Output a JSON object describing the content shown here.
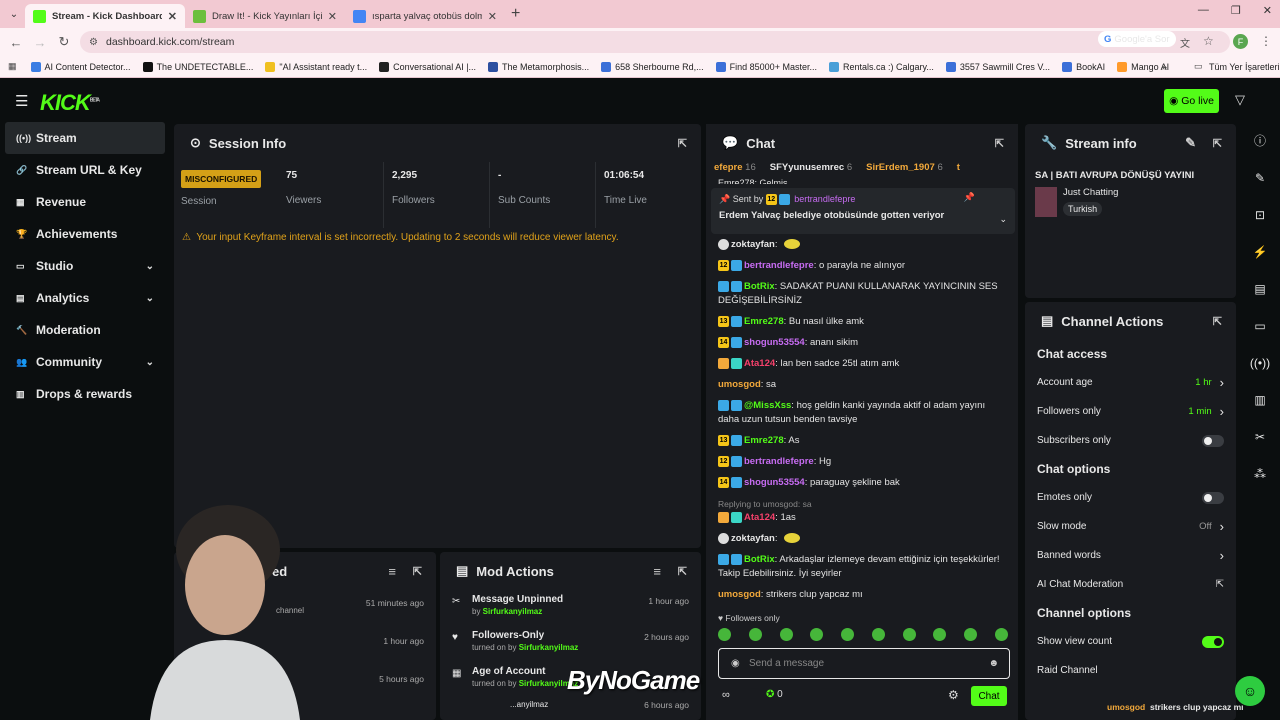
{
  "browser": {
    "tabs": [
      {
        "title": "Stream - Kick Dashboard",
        "color": "#53fc18",
        "active": true
      },
      {
        "title": "Draw It! - Kick Yayınları İçin Çizi",
        "color": "#6cbf3c",
        "active": false
      },
      {
        "title": "ısparta yalvaç otobüs dolmuş",
        "color": "#4285f4",
        "active": false
      }
    ],
    "new_tab": "+",
    "url": "dashboard.kick.com/stream",
    "google_label": "Google'a Sor",
    "profile_initial": "F",
    "bookmarks": [
      {
        "label": "AI Content Detector...",
        "color": "#3b7de3"
      },
      {
        "label": "The UNDETECTABLE...",
        "color": "#111111"
      },
      {
        "label": "\"AI Assistant ready t...",
        "color": "#f0c020"
      },
      {
        "label": "Conversational AI |...",
        "color": "#222222"
      },
      {
        "label": "The Metamorphosis...",
        "color": "#2d4fa0"
      },
      {
        "label": "658 Sherbourne Rd,...",
        "color": "#3c6fd8"
      },
      {
        "label": "Find 85000+ Master...",
        "color": "#3c6fd8"
      },
      {
        "label": "Rentals.ca :) Calgary...",
        "color": "#4a9fd8"
      },
      {
        "label": "3557 Sawmill Cres V...",
        "color": "#3c6fd8"
      },
      {
        "label": "BookAI",
        "color": "#3c6fd8"
      },
      {
        "label": "Mango AI",
        "color": "#ff9a2a"
      }
    ],
    "all_bookmarks": "Tüm Yer İşaretleri"
  },
  "app": {
    "logo": "KICK",
    "logo_beta": "BETA",
    "go_live": "Go live"
  },
  "sidebar": {
    "items": [
      {
        "label": "Stream",
        "icon": "stream-icon",
        "active": true,
        "chev": false
      },
      {
        "label": "Stream URL & Key",
        "icon": "link-icon",
        "active": false,
        "chev": false
      },
      {
        "label": "Revenue",
        "icon": "revenue-icon",
        "active": false,
        "chev": false
      },
      {
        "label": "Achievements",
        "icon": "trophy-icon",
        "active": false,
        "chev": false
      },
      {
        "label": "Studio",
        "icon": "studio-icon",
        "active": false,
        "chev": true
      },
      {
        "label": "Analytics",
        "icon": "analytics-icon",
        "active": false,
        "chev": true
      },
      {
        "label": "Moderation",
        "icon": "hammer-icon",
        "active": false,
        "chev": false
      },
      {
        "label": "Community",
        "icon": "community-icon",
        "active": false,
        "chev": true
      },
      {
        "label": "Drops & rewards",
        "icon": "drops-icon",
        "active": false,
        "chev": false
      }
    ]
  },
  "session": {
    "title": "Session Info",
    "status": "MISCONFIGURED",
    "status_label": "Session",
    "stats": [
      {
        "value": "75",
        "label": "Viewers"
      },
      {
        "value": "2,295",
        "label": "Followers"
      },
      {
        "value": "-",
        "label": "Sub Counts"
      },
      {
        "value": "01:06:54",
        "label": "Time Live"
      }
    ],
    "warning": "Your input Keyframe interval is set incorrectly. Updating to 2 seconds will reduce viewer latency."
  },
  "recent": {
    "title": "ed",
    "rows": [
      {
        "text": "channel",
        "time": "51 minutes ago"
      },
      {
        "text": "",
        "time": "1 hour ago"
      },
      {
        "text": "",
        "time": "5 hours ago"
      }
    ]
  },
  "mod_actions": {
    "title": "Mod Actions",
    "rows": [
      {
        "icon": "unpin-icon",
        "glyph": "✂",
        "title": "Message Unpinned",
        "prefix": "by ",
        "by": "Sirfurkanyilmaz",
        "time": "1 hour ago"
      },
      {
        "icon": "heart-icon",
        "glyph": "♥",
        "title": "Followers-Only",
        "prefix": "turned on by ",
        "by": "Sirfurkanyilmaz",
        "time": "2 hours ago"
      },
      {
        "icon": "calendar-icon",
        "glyph": "▦",
        "title": "Age of Account",
        "prefix": "turned on by ",
        "by": "Sirfurkanyilmaz",
        "time": ""
      }
    ],
    "partial_row": {
      "by": "...anyilmaz",
      "time": "6 hours ago"
    }
  },
  "chat": {
    "title": "Chat",
    "leaderboard": [
      {
        "name": "efepre",
        "count": "16",
        "color": "#f2a93b"
      },
      {
        "name": "SFYyunusemrec",
        "count": "6",
        "color": "#e8e8e8"
      },
      {
        "name": "SirErdem_1907",
        "count": "6",
        "color": "#f2a93b"
      },
      {
        "name": "t",
        "count": "",
        "color": "#f2a93b"
      }
    ],
    "partial_top": "Emre278: Gelmis",
    "pinned": {
      "sent_by": "Sent by",
      "badge": "12",
      "user": "bertrandlefepre",
      "text": "Erdem Yalvaç belediye otobüsünde gotten veriyor"
    },
    "messages": [
      {
        "badges": [],
        "user": "zoktayfan",
        "color": "#e8e8e8",
        "text": "",
        "emote": true
      },
      {
        "badges": [
          "12"
        ],
        "user": "bertrandlefepre",
        "color": "#c76cf2",
        "text": "o parayla ne alınıyor"
      },
      {
        "badges": [
          "bot"
        ],
        "user": "BotRix",
        "color": "#53fc18",
        "text": "SADAKAT PUANI KULLANARAK YAYINCININ SES DEĞİŞEBİLİRSİNİZ"
      },
      {
        "badges": [
          "13"
        ],
        "user": "Emre278",
        "color": "#53fc18",
        "text": "Bu nasıl ülke amk"
      },
      {
        "badges": [
          "14"
        ],
        "user": "shogun53554",
        "color": "#c76cf2",
        "text": "ananı sikim"
      },
      {
        "badges": [
          "mod"
        ],
        "user": "Ata124",
        "color": "#f5416b",
        "text": "lan ben sadce 25tl atım amk"
      },
      {
        "badges": [],
        "user": "umosgod",
        "color": "#f2a93b",
        "text": "sa"
      },
      {
        "badges": [
          "bot"
        ],
        "user": "@MissXss",
        "color": "#53fc18",
        "text": "hoş geldin kanki yayında aktif ol adam yayını daha uzun tutsun benden tavsiye"
      },
      {
        "badges": [
          "13"
        ],
        "user": "Emre278",
        "color": "#53fc18",
        "text": "As"
      },
      {
        "badges": [
          "12"
        ],
        "user": "bertrandlefepre",
        "color": "#c76cf2",
        "text": "Hg"
      },
      {
        "badges": [
          "14"
        ],
        "user": "shogun53554",
        "color": "#c76cf2",
        "text": "paraguay şekline bak"
      },
      {
        "badges": [
          "mod"
        ],
        "user": "Ata124",
        "color": "#f5416b",
        "text": "1as",
        "reply": "Replying to umosgod: sa"
      },
      {
        "badges": [],
        "user": "zoktayfan",
        "color": "#e8e8e8",
        "text": "",
        "emote": true
      },
      {
        "badges": [
          "bot"
        ],
        "user": "BotRix",
        "color": "#53fc18",
        "text": "Arkadaşlar izlemeye devam ettiğiniz için teşekkürler! Takip Edebilirsiniz. İyi seyirler"
      },
      {
        "badges": [],
        "user": "umosgod",
        "color": "#f2a93b",
        "text": "strikers clup yapcaz mı"
      }
    ],
    "followers_only": "Followers only",
    "placeholder": "Send a message",
    "bottom_count": "0",
    "chat_button": "Chat"
  },
  "stream_info": {
    "title": "Stream info",
    "stream_title": "SA | BATI AVRUPA DÖNÜŞÜ YAYINI",
    "category": "Just Chatting",
    "tag": "Turkish"
  },
  "channel_actions": {
    "title": "Channel Actions",
    "sections": [
      {
        "header": "Chat access",
        "rows": [
          {
            "label": "Account age",
            "value": "1 hr",
            "kind": "link"
          },
          {
            "label": "Followers only",
            "value": "1 min",
            "kind": "link"
          },
          {
            "label": "Subscribers only",
            "value": "",
            "kind": "toggle-off"
          }
        ]
      },
      {
        "header": "Chat options",
        "rows": [
          {
            "label": "Emotes only",
            "value": "",
            "kind": "toggle-off"
          },
          {
            "label": "Slow mode",
            "value": "Off",
            "kind": "link"
          },
          {
            "label": "Banned words",
            "value": "",
            "kind": "link"
          },
          {
            "label": "AI Chat Moderation",
            "value": "",
            "kind": "ext"
          }
        ]
      },
      {
        "header": "Channel options",
        "rows": [
          {
            "label": "Show view count",
            "value": "",
            "kind": "toggle-on"
          },
          {
            "label": "Raid Channel",
            "value": "",
            "kind": "none"
          }
        ]
      }
    ],
    "overlay_user": "umosgod",
    "overlay_text": "strikers clup yapcaz mı"
  },
  "watermark": "ByNoGame"
}
